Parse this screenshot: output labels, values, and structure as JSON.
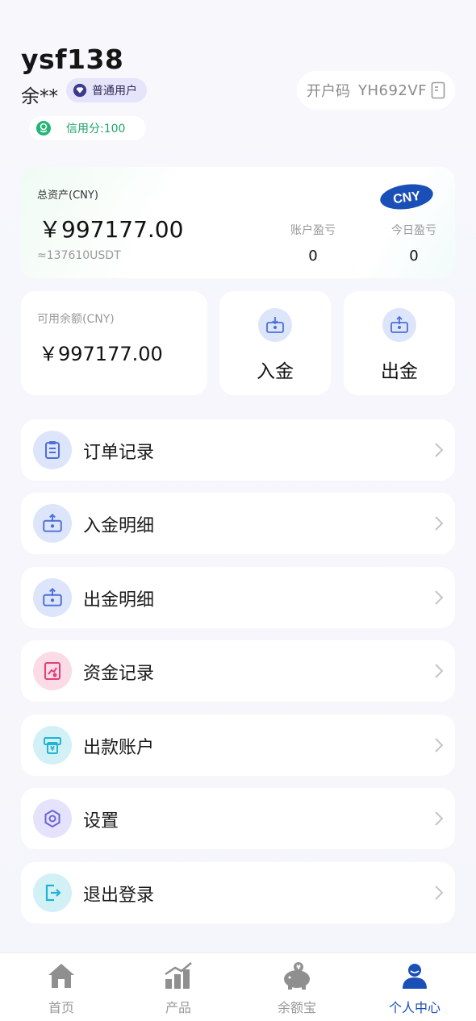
{
  "header": {
    "username": "ysf138",
    "realname": "余**",
    "user_level": "普通用户",
    "credit": "信用分:100",
    "invite_label": "开户码",
    "invite_code": "YH692VF"
  },
  "assets": {
    "total_label": "总资产(CNY)",
    "total_amount": "￥997177.00",
    "usdt": "≈137610USDT",
    "currency_badge": "CNY",
    "pl_label": "账户盈亏",
    "pl_value": "0",
    "today_label": "今日盈亏",
    "today_value": "0"
  },
  "balance": {
    "label": "可用余额(CNY)",
    "amount": "￥997177.00"
  },
  "actions": {
    "deposit": "入金",
    "withdraw": "出金"
  },
  "menu": {
    "items": [
      {
        "label": "订单记录",
        "icon": "clipboard-icon"
      },
      {
        "label": "入金明细",
        "icon": "deposit-icon"
      },
      {
        "label": "出金明细",
        "icon": "withdraw-icon"
      },
      {
        "label": "资金记录",
        "icon": "funds-record-icon"
      },
      {
        "label": "出款账户",
        "icon": "atm-icon"
      },
      {
        "label": "设置",
        "icon": "hexagon-settings-icon"
      },
      {
        "label": "退出登录",
        "icon": "logout-icon"
      }
    ]
  },
  "tabs": {
    "home": "首页",
    "product": "产品",
    "yuebao": "余额宝",
    "profile": "个人中心"
  },
  "colors": {
    "accent": "#1b4fb8",
    "credit_green": "#1da36b",
    "badge_bg": "#e6e4fb",
    "page_bg": "#f5f6fb"
  }
}
